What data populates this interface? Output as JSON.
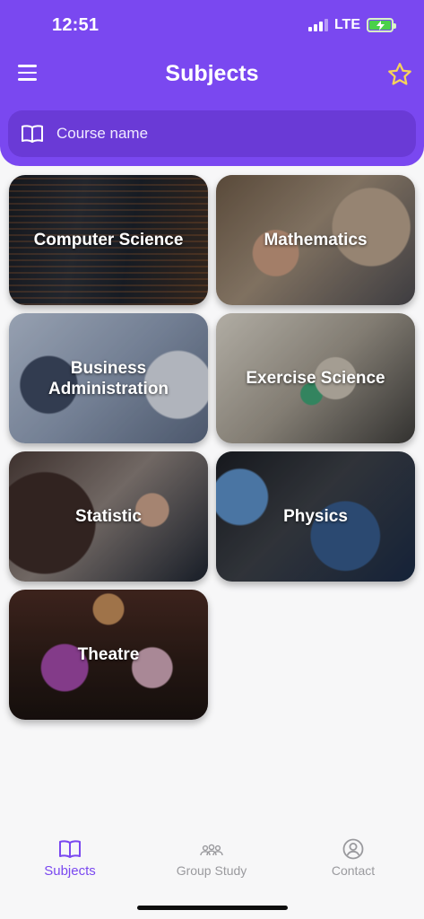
{
  "status_bar": {
    "time": "12:51",
    "network": "LTE",
    "icons": [
      "signal-icon",
      "battery-charging-icon"
    ]
  },
  "header": {
    "title": "Subjects",
    "menu_icon": "hamburger-menu-icon",
    "favorite_icon": "star-icon",
    "accent_color": "#7a48f0",
    "star_color": "#f6d35a"
  },
  "search": {
    "icon": "book-icon",
    "placeholder": "Course name",
    "value": ""
  },
  "subjects": [
    {
      "label": "Computer Science"
    },
    {
      "label": "Mathematics"
    },
    {
      "label": "Business Administration"
    },
    {
      "label": "Exercise Science"
    },
    {
      "label": "Statistic"
    },
    {
      "label": "Physics"
    },
    {
      "label": "Theatre"
    }
  ],
  "bottom_nav": {
    "items": [
      {
        "label": "Subjects",
        "icon": "book-icon",
        "active": true
      },
      {
        "label": "Group Study",
        "icon": "group-icon",
        "active": false
      },
      {
        "label": "Contact",
        "icon": "user-circle-icon",
        "active": false
      }
    ],
    "active_color": "#7a48f0",
    "inactive_color": "#9a9a9e"
  }
}
